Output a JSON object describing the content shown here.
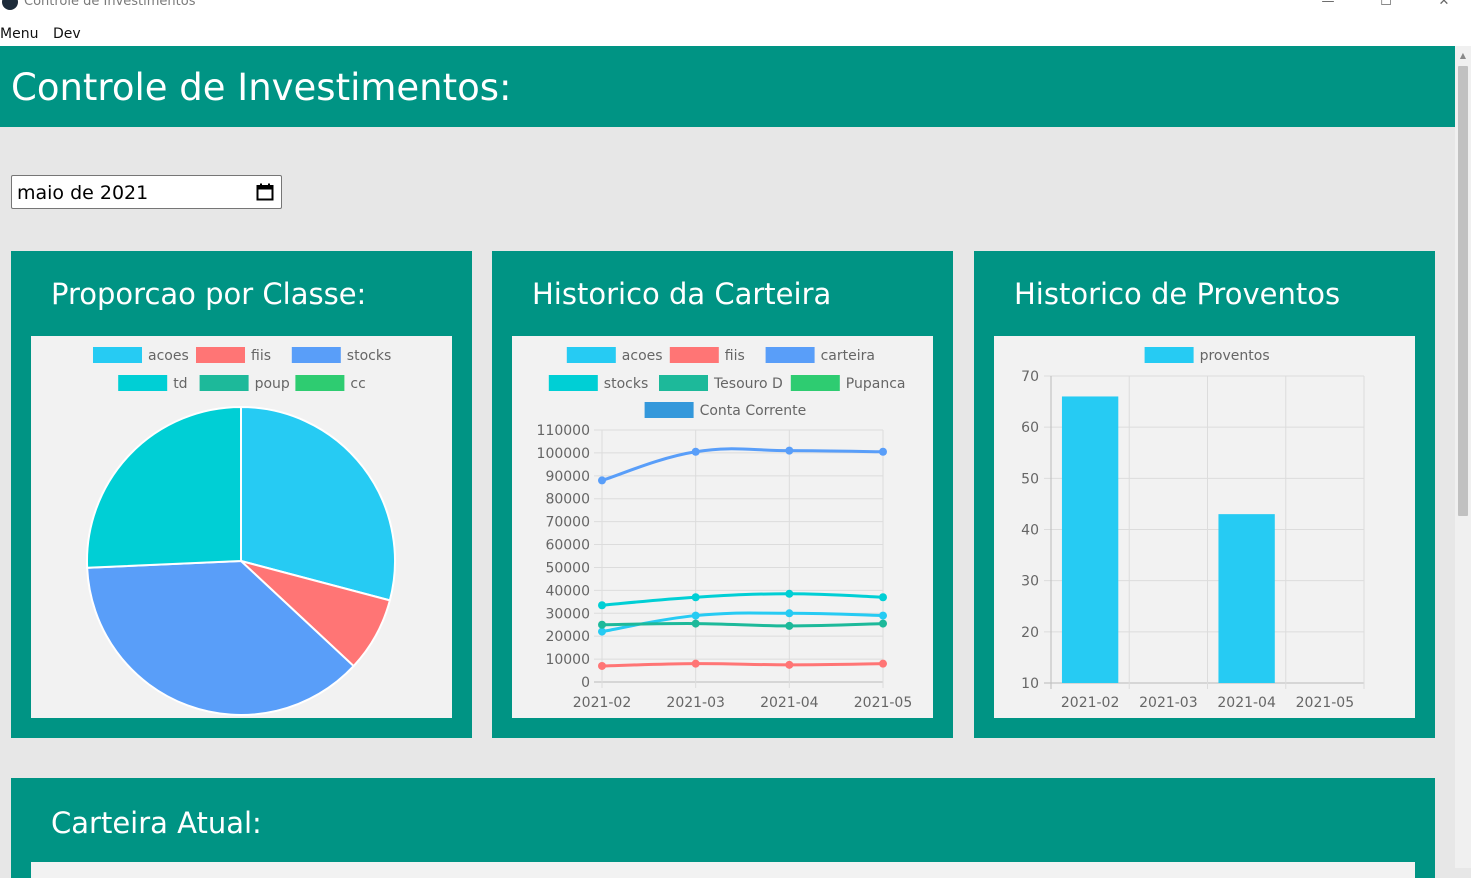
{
  "window": {
    "title": "Controle de Investimentos"
  },
  "menu": {
    "items": [
      {
        "label": "Menu"
      },
      {
        "label": "Dev"
      }
    ]
  },
  "header": {
    "title": "Controle de Investimentos:"
  },
  "date_input": {
    "value": "maio de 2021"
  },
  "cards": {
    "pie": {
      "title": "Proporcao por Classe:"
    },
    "line": {
      "title": "Historico da Carteira"
    },
    "bar": {
      "title": "Historico de Proventos"
    }
  },
  "bottom": {
    "title": "Carteira Atual:"
  },
  "chart_data": [
    {
      "type": "pie",
      "title": "Proporcao por Classe:",
      "legend_position": "top",
      "slices": [
        {
          "label": "acoes",
          "value": 29000,
          "color": "#26cbf3"
        },
        {
          "label": "fiis",
          "value": 7800,
          "color": "#ff7575"
        },
        {
          "label": "stocks",
          "value": 37200,
          "color": "#599ef9"
        },
        {
          "label": "td",
          "value": 25600,
          "color": "#00cfd5"
        },
        {
          "label": "poup",
          "value": 0,
          "color": "#1db99a"
        },
        {
          "label": "cc",
          "value": 0,
          "color": "#2ecc71"
        }
      ]
    },
    {
      "type": "line",
      "title": "Historico da Carteira",
      "legend_position": "top",
      "categories": [
        "2021-02",
        "2021-03",
        "2021-04",
        "2021-05"
      ],
      "ylim": [
        0,
        110000
      ],
      "yticks": [
        0,
        10000,
        20000,
        30000,
        40000,
        50000,
        60000,
        70000,
        80000,
        90000,
        100000,
        110000
      ],
      "grid": true,
      "series": [
        {
          "name": "acoes",
          "color": "#26cbf3",
          "values": [
            22000,
            29000,
            30000,
            29000
          ]
        },
        {
          "name": "fiis",
          "color": "#ff7575",
          "values": [
            7000,
            8000,
            7500,
            8000
          ]
        },
        {
          "name": "carteira",
          "color": "#599ef9",
          "values": [
            88000,
            100500,
            101000,
            100500
          ]
        },
        {
          "name": "stocks",
          "color": "#00cfd5",
          "values": [
            33500,
            37000,
            38500,
            37000
          ]
        },
        {
          "name": "Tesouro D",
          "color": "#1db99a",
          "values": [
            25000,
            25500,
            24500,
            25500
          ]
        },
        {
          "name": "Pupanca",
          "color": "#2ecc71",
          "values": []
        },
        {
          "name": "Conta Corrente",
          "color": "#3498db",
          "values": []
        }
      ]
    },
    {
      "type": "bar",
      "title": "Historico de Proventos",
      "legend_position": "top",
      "categories": [
        "2021-02",
        "2021-03",
        "2021-04",
        "2021-05"
      ],
      "ylim": [
        10,
        70
      ],
      "yticks": [
        10,
        20,
        30,
        40,
        50,
        60,
        70
      ],
      "grid": true,
      "series": [
        {
          "name": "proventos",
          "color": "#26cbf3",
          "values": [
            66,
            null,
            43,
            null
          ]
        }
      ]
    }
  ]
}
